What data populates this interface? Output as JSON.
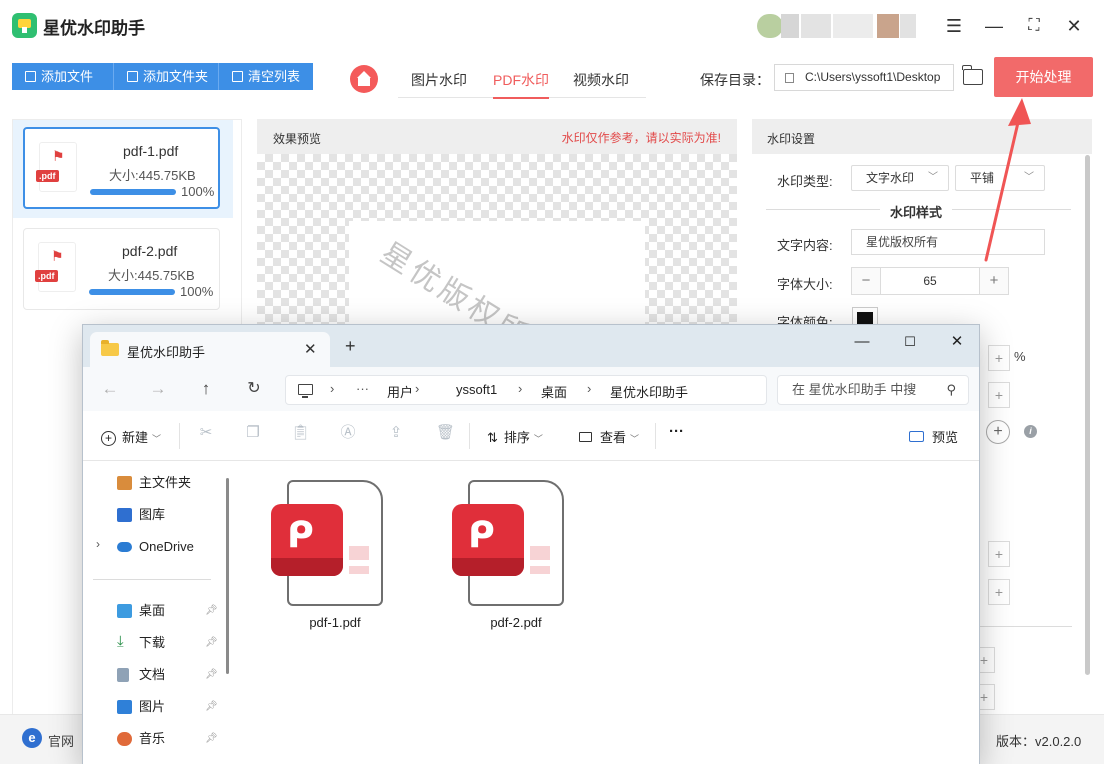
{
  "app": {
    "title": "星优水印助手",
    "window_controls": [
      "settings-sliders",
      "minimize",
      "maximize",
      "close"
    ]
  },
  "toolbar": {
    "add_file": "添加文件",
    "add_folder": "添加文件夹",
    "clear_list": "清空列表",
    "mode_tabs": [
      "图片水印",
      "PDF水印",
      "视频水印"
    ],
    "active_mode": "PDF水印",
    "save_label": "保存目录：",
    "save_path": "C:\\Users\\yssoft1\\Desktop",
    "start": "开始处理"
  },
  "files": [
    {
      "name": "pdf-1.pdf",
      "size": "大小:445.75KB",
      "progress": "100%",
      "progress_value": 1.0,
      "selected": true,
      "ext": ".pdf"
    },
    {
      "name": "pdf-2.pdf",
      "size": "大小:445.75KB",
      "progress": "100%",
      "progress_value": 1.0,
      "selected": false,
      "ext": ".pdf"
    }
  ],
  "preview": {
    "title": "效果预览",
    "note": "水印仅作参考，请以实际为准!",
    "watermark_text": "星优版权所有"
  },
  "settings": {
    "title": "水印设置",
    "type_label": "水印类型:",
    "type_value": "文字水印",
    "layout_value": "平铺",
    "section_style": "水印样式",
    "text_label": "文字内容:",
    "text_value": "星优版权所有",
    "size_label": "字体大小:",
    "size_value": "65",
    "minus": "−",
    "plus": "+",
    "color_label": "字体颜色:",
    "color_value": "#111111",
    "percent": "%"
  },
  "footer": {
    "site": "官网",
    "version": "版本：v2.0.2.0"
  },
  "explorer": {
    "tab_title": "星优水印助手",
    "breadcrumbs": [
      "用户",
      "yssoft1",
      "桌面",
      "星优水印助手"
    ],
    "search_placeholder": "在 星优水印助手 中搜",
    "commands": {
      "new": "新建",
      "sort": "排序",
      "view": "查看",
      "more": "···",
      "preview": "预览"
    },
    "nav": {
      "home": "主文件夹",
      "gallery": "图库",
      "onedrive": "OneDrive",
      "quick": [
        {
          "label": "桌面"
        },
        {
          "label": "下载"
        },
        {
          "label": "文档"
        },
        {
          "label": "图片"
        },
        {
          "label": "音乐"
        }
      ]
    },
    "files": [
      {
        "name": "pdf-1.pdf"
      },
      {
        "name": "pdf-2.pdf"
      }
    ]
  },
  "colors": {
    "accent_blue": "#3d8fe6",
    "accent_red": "#f26a6a",
    "pdf_red": "#e02f3a"
  }
}
